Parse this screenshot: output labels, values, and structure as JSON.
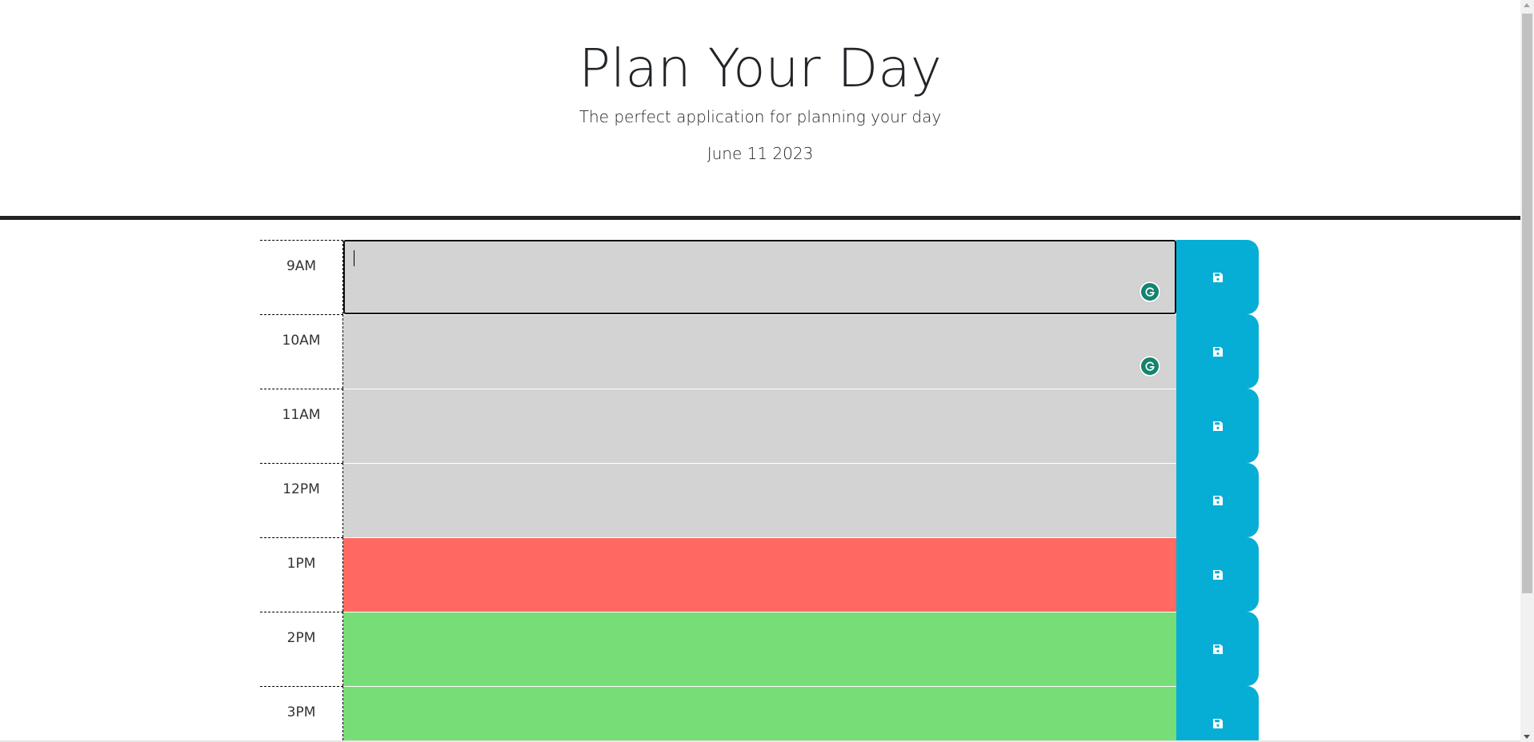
{
  "header": {
    "title": "Plan Your Day",
    "lead": "The perfect application for planning your day",
    "current_day": "June 11 2023"
  },
  "colors": {
    "past": "#d3d3d3",
    "present": "#ff6961",
    "future": "#77dd77",
    "save_button": "#06aed5",
    "grammarly": "#15846f"
  },
  "save_icon": "floppy-disk-icon",
  "rows": [
    {
      "hour": "9AM",
      "status": "past",
      "text": ""
    },
    {
      "hour": "10AM",
      "status": "past",
      "text": ""
    },
    {
      "hour": "11AM",
      "status": "past",
      "text": ""
    },
    {
      "hour": "12PM",
      "status": "past",
      "text": ""
    },
    {
      "hour": "1PM",
      "status": "present",
      "text": ""
    },
    {
      "hour": "2PM",
      "status": "future",
      "text": ""
    },
    {
      "hour": "3PM",
      "status": "future",
      "text": ""
    }
  ]
}
